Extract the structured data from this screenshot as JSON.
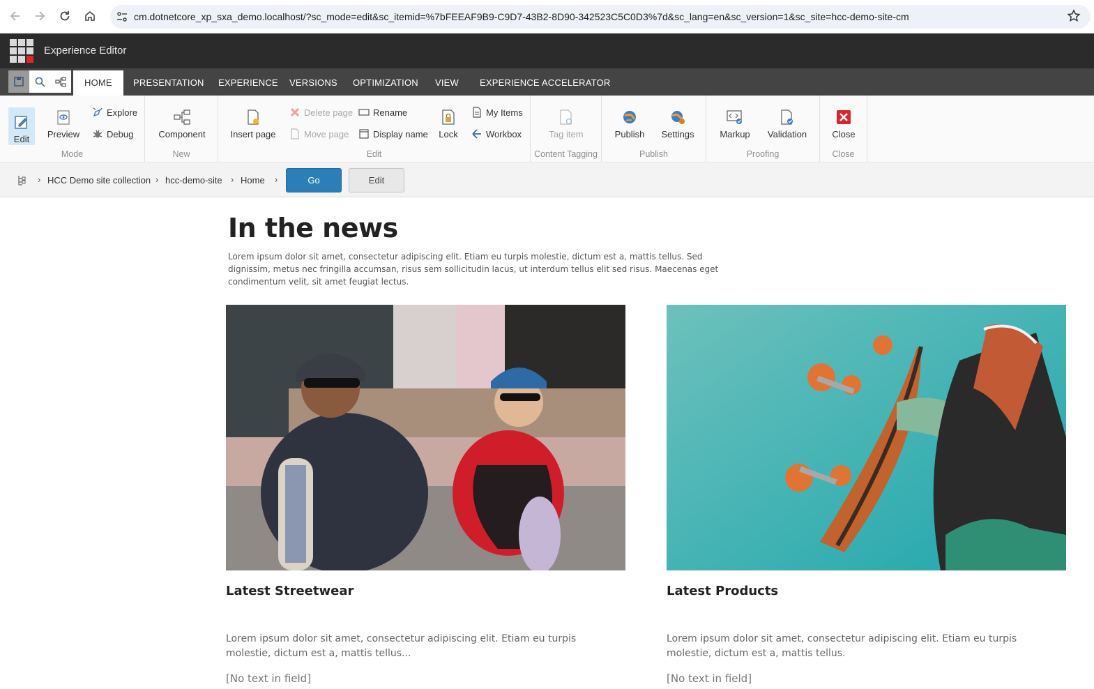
{
  "browser": {
    "url": "cm.dotnetcore_xp_sxa_demo.localhost/?sc_mode=edit&sc_itemid=%7bFEEAF9B9-C9D7-43B2-8D90-342523C5C0D3%7d&sc_lang=en&sc_version=1&sc_site=hcc-demo-site-cm"
  },
  "header": {
    "title": "Experience Editor"
  },
  "tabs": [
    {
      "label": "HOME"
    },
    {
      "label": "PRESENTATION"
    },
    {
      "label": "EXPERIENCE"
    },
    {
      "label": "VERSIONS"
    },
    {
      "label": "OPTIMIZATION"
    },
    {
      "label": "VIEW"
    },
    {
      "label": "EXPERIENCE ACCELERATOR"
    }
  ],
  "ribbon": {
    "mode": {
      "label": "Mode",
      "edit": "Edit",
      "preview": "Preview",
      "explore": "Explore",
      "debug": "Debug"
    },
    "new": {
      "label": "New",
      "component": "Component"
    },
    "edit": {
      "label": "Edit",
      "insert_page": "Insert page",
      "delete_page": "Delete page",
      "move_page": "Move page",
      "rename": "Rename",
      "display_name": "Display name",
      "lock": "Lock",
      "my_items": "My Items",
      "workbox": "Workbox"
    },
    "content_tagging": {
      "label": "Content Tagging",
      "tag_item": "Tag item"
    },
    "publish": {
      "label": "Publish",
      "publish": "Publish",
      "settings": "Settings"
    },
    "proofing": {
      "label": "Proofing",
      "markup": "Markup",
      "validation": "Validation"
    },
    "close": {
      "label": "Close",
      "close": "Close"
    }
  },
  "breadcrumb": {
    "items": [
      "HCC Demo site collection",
      "hcc-demo-site",
      "Home"
    ],
    "go": "Go",
    "edit": "Edit"
  },
  "page": {
    "title": "In the news",
    "intro": "Lorem ipsum dolor sit amet, consectetur adipiscing elit. Etiam eu turpis molestie, dictum est a, mattis tellus. Sed dignissim, metus nec fringilla accumsan, risus sem sollicitudin lacus, ut interdum tellus elit sed risus. Maecenas eget condimentum velit, sit amet feugiat lectus.",
    "cards": [
      {
        "title": "Latest Streetwear",
        "text": "Lorem ipsum dolor sit amet, consectetur adipiscing elit. Etiam eu turpis molestie, dictum est a, mattis tellus...",
        "empty": "[No text in field]"
      },
      {
        "title": "Latest Products",
        "text": "Lorem ipsum dolor sit amet, consectetur adipiscing elit. Etiam eu turpis molestie, dictum est a, mattis tellus.",
        "empty": "[No text in field]"
      }
    ]
  },
  "colors": {
    "accent": "#2b7fb6",
    "header_bg": "#2b2b2b",
    "tabs_bg": "#444444",
    "close_red": "#e0262a"
  }
}
